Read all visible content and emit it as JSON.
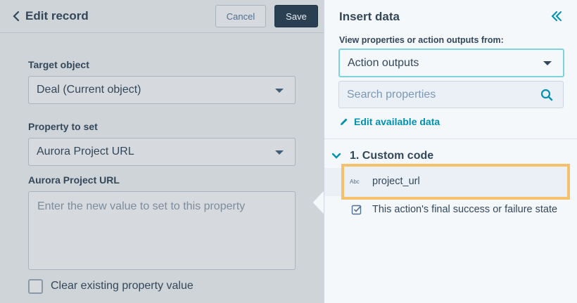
{
  "editor": {
    "title": "Edit record",
    "cancel_label": "Cancel",
    "save_label": "Save",
    "target_object_label": "Target object",
    "target_object_value": "Deal (Current object)",
    "property_label": "Property to set",
    "property_value": "Aurora Project URL",
    "value_label": "Aurora Project URL",
    "value_placeholder": "Enter the new value to set to this property",
    "clear_checkbox_label": "Clear existing property value"
  },
  "insert_panel": {
    "title": "Insert data",
    "view_label": "View properties or action outputs from:",
    "source_value": "Action outputs",
    "search_placeholder": "Search properties",
    "edit_link": "Edit available data",
    "section_title": "1. Custom code",
    "items": [
      {
        "type_badge": "Abc",
        "label": "project_url",
        "icon": "text-type-icon"
      },
      {
        "label": "This action's final success or failure state",
        "icon": "checkbox-state-icon"
      }
    ]
  },
  "colors": {
    "highlight": "#f5c26b",
    "accent": "#0091ae",
    "focus_border": "#7fd1de"
  }
}
